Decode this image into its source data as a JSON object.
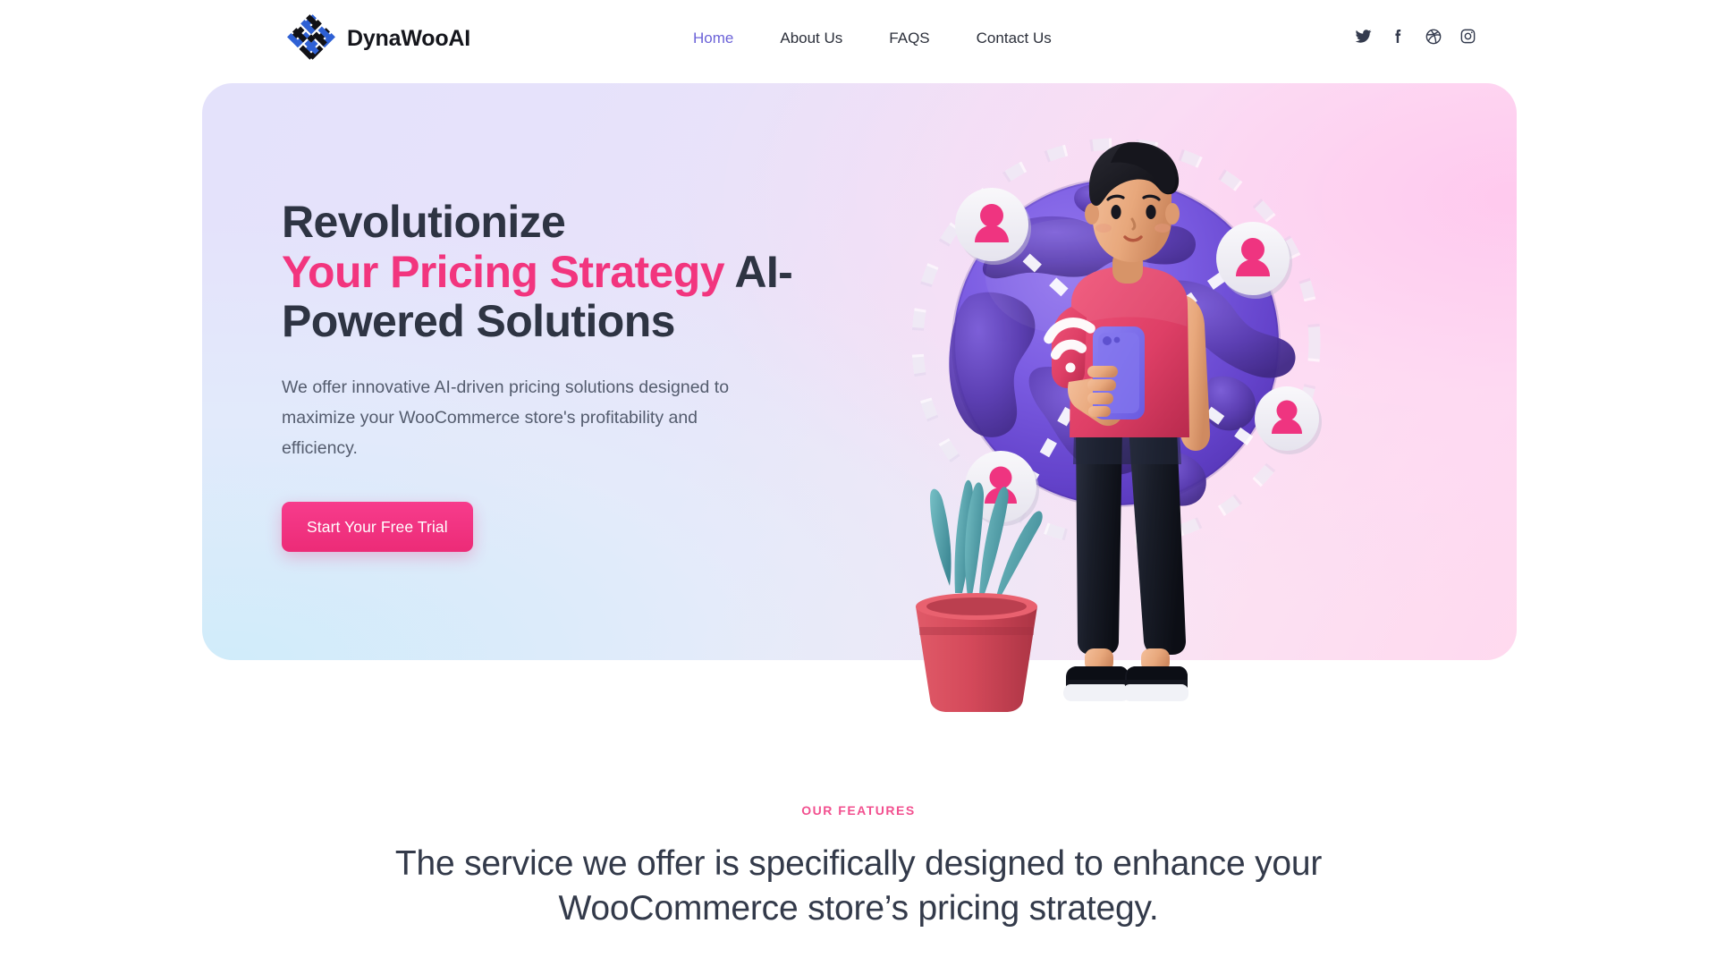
{
  "header": {
    "brand": {
      "name": "DynaWooAI",
      "logo_icon": "woven-diamond-logo-icon"
    },
    "nav": [
      {
        "label": "Home",
        "active": true
      },
      {
        "label": "About Us",
        "active": false
      },
      {
        "label": "FAQS",
        "active": false
      },
      {
        "label": "Contact Us",
        "active": false
      }
    ],
    "social": [
      {
        "name": "twitter-icon"
      },
      {
        "name": "facebook-icon"
      },
      {
        "name": "dribbble-icon"
      },
      {
        "name": "instagram-icon"
      }
    ]
  },
  "hero": {
    "title_line1": "Revolutionize",
    "title_accent": "Your Pricing Strategy",
    "title_rest": " AI-Powered Solutions",
    "subtitle": "We offer innovative AI-driven pricing solutions designed to maximize your WooCommerce store's profitability and efficiency.",
    "cta_label": "Start Your Free Trial",
    "illustration": {
      "alt": "3D globe with connected user avatars and a person holding a smartphone",
      "avatar_count": 5,
      "globe_color": "#6b4bc9",
      "avatar_color": "#ef3480",
      "character": {
        "shirt_color": "#e0456d",
        "pants_color": "#1c1f2a",
        "phone_color": "#7a6ce8",
        "hair_color": "#1b1b22"
      },
      "plant": {
        "pot_color": "#d9485b",
        "leaf_color": "#5ba8b2"
      }
    }
  },
  "features": {
    "eyebrow": "OUR FEATURES",
    "heading": "The service we offer is specifically designed to enhance your WooCommerce store’s pricing strategy."
  },
  "colors": {
    "accent_pink": "#f2357e",
    "nav_active": "#6c63d8",
    "heading_dark": "#2e3443",
    "body_text": "#545c6e"
  }
}
